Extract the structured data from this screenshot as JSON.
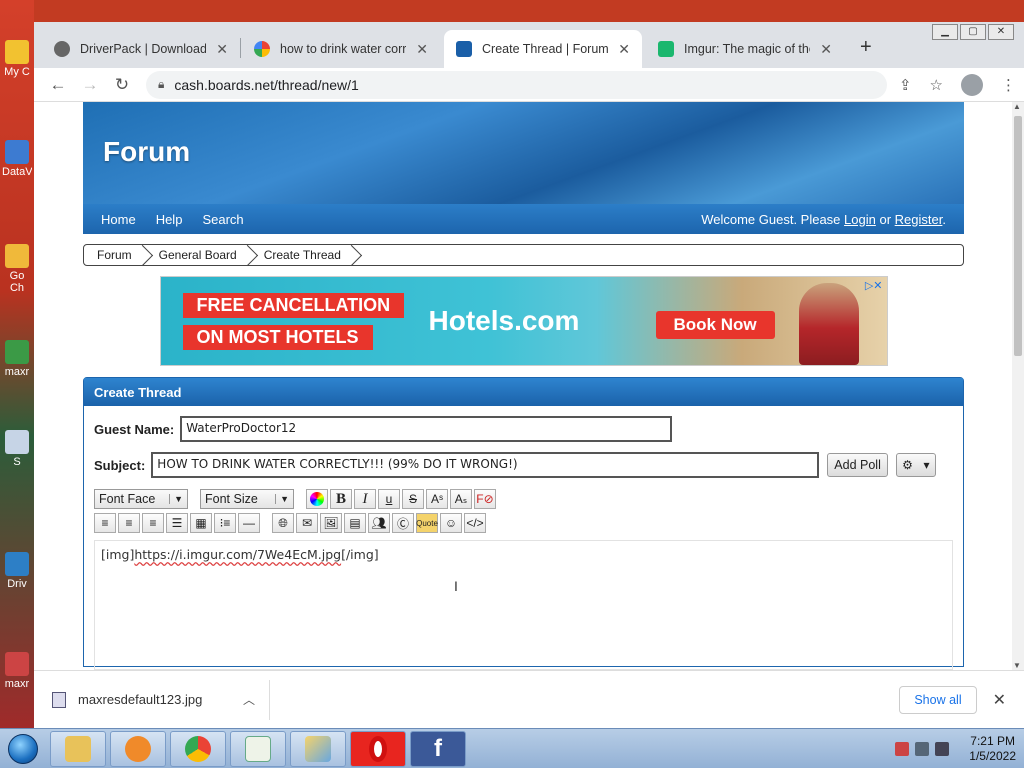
{
  "desktop": {
    "icons": [
      "My C",
      "DataV",
      "Go Ch",
      "maxr",
      "S",
      "Driv",
      "maxr"
    ]
  },
  "browser": {
    "tabs": [
      {
        "label": "DriverPack | Download fre",
        "color": "#666666"
      },
      {
        "label": "how to drink water correc",
        "color": "#4285f4"
      },
      {
        "label": "Create Thread | Forum",
        "color": "#1a5fa8"
      },
      {
        "label": "Imgur: The magic of the I",
        "color": "#1bb76e"
      }
    ],
    "new_tab": "+",
    "address": "cash.boards.net/thread/new/1"
  },
  "forum": {
    "logo": "Forum",
    "nav": [
      "Home",
      "Help",
      "Search"
    ],
    "welcome_prefix": "Welcome Guest. Please",
    "login": "Login",
    "or": "or",
    "register": "Register",
    "breadcrumbs": [
      "Forum",
      "General Board",
      "Create Thread"
    ]
  },
  "ad": {
    "line1": "FREE CANCELLATION",
    "line2": "ON MOST HOTELS",
    "brand": "Hotels.com",
    "cta": "Book Now"
  },
  "form": {
    "panel_title": "Create Thread",
    "guest_label": "Guest Name:",
    "guest_value": "WaterProDoctor12",
    "subject_label": "Subject:",
    "subject_value": "HOW TO DRINK WATER CORRECTLY!!! (99% DO IT WRONG!)",
    "add_poll": "Add Poll",
    "font_face": "Font Face",
    "font_size": "Font Size",
    "editor_open": "[img]",
    "editor_url": "https://i.imgur.com/7We4EcM.jpg",
    "editor_close": "[/img]"
  },
  "download": {
    "file": "maxresdefault123.jpg",
    "show_all": "Show all"
  },
  "taskbar": {
    "time": "7:21 PM",
    "date": "1/5/2022"
  }
}
